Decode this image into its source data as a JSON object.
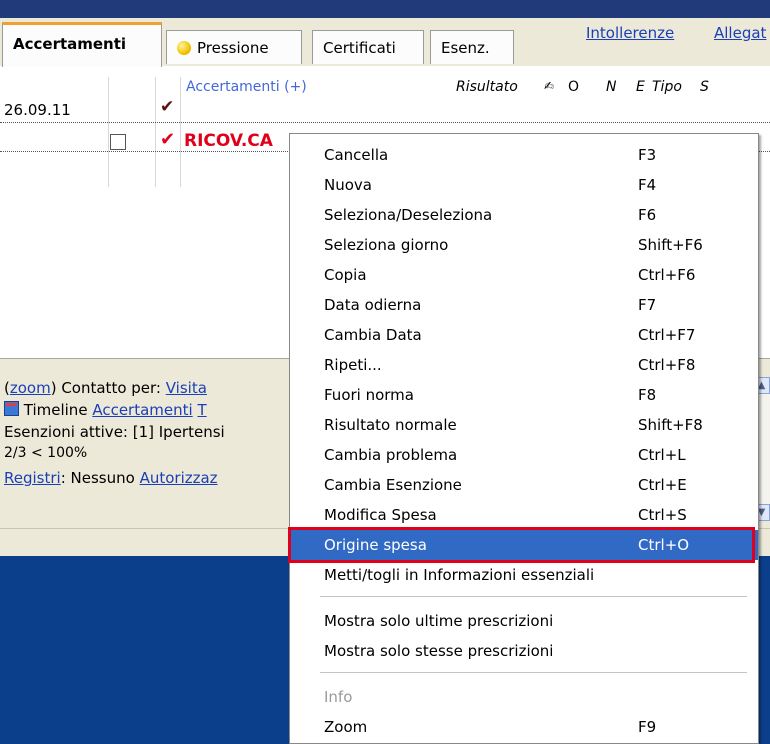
{
  "tabs": [
    {
      "label": "Accertamenti",
      "active": true
    },
    {
      "label": "Pressione",
      "active": false,
      "icon": "yellow-circle-icon"
    },
    {
      "label": "Certificati",
      "active": false
    },
    {
      "label": "Esenz.",
      "active": false
    }
  ],
  "top_links": [
    "Intollerenze",
    "Allegat"
  ],
  "grid": {
    "header": {
      "accertamenti": "Accertamenti (+)",
      "risultato": "Risultato",
      "col_icon": "✍",
      "o": "O",
      "n": "N",
      "e": "E",
      "tipo": "Tipo",
      "s": "S"
    },
    "rows": [
      {
        "date": "26.09.11",
        "check": "✔"
      },
      {
        "check": "✔",
        "name": "RICOV.CA"
      }
    ]
  },
  "info": {
    "line1_zoom": "zoom",
    "line1_paren_open": "(",
    "line1_paren_close": ")",
    "line1_text": " Contatto per: ",
    "line1_link": "Visita",
    "line2_text": " Timeline ",
    "line2_link1": "Accertamenti",
    "line2_link2": "T",
    "line3_text": "Esenzioni attive: [1] Ipertensi",
    "line4_text": "2/3 < 100%",
    "line5_link1": "Registri",
    "line5_text": ": Nessuno ",
    "line5_link2": "Autorizzaz"
  },
  "context_menu": {
    "items": [
      {
        "label": "Cancella",
        "shortcut": "F3"
      },
      {
        "label": "Nuova",
        "shortcut": "F4"
      },
      {
        "label": "Seleziona/Deseleziona",
        "shortcut": "F6"
      },
      {
        "label": "Seleziona giorno",
        "shortcut": "Shift+F6"
      },
      {
        "label": "Copia",
        "shortcut": "Ctrl+F6"
      },
      {
        "label": "Data odierna",
        "shortcut": "F7"
      },
      {
        "label": "Cambia Data",
        "shortcut": "Ctrl+F7"
      },
      {
        "label": "Ripeti...",
        "shortcut": "Ctrl+F8"
      },
      {
        "label": "Fuori norma",
        "shortcut": "F8"
      },
      {
        "label": "Risultato normale",
        "shortcut": "Shift+F8"
      },
      {
        "label": "Cambia problema",
        "shortcut": "Ctrl+L"
      },
      {
        "label": "Cambia Esenzione",
        "shortcut": "Ctrl+E"
      },
      {
        "label": "Modifica Spesa",
        "shortcut": "Ctrl+S"
      },
      {
        "label": "Origine spesa",
        "shortcut": "Ctrl+O",
        "selected": true
      },
      {
        "label": "Metti/togli in Informazioni essenziali",
        "shortcut": ""
      },
      {
        "label": "Mostra solo ultime prescrizioni",
        "shortcut": ""
      },
      {
        "label": "Mostra solo stesse prescrizioni",
        "shortcut": ""
      },
      {
        "label": "Info",
        "shortcut": "",
        "disabled": true
      },
      {
        "label": "Zoom",
        "shortcut": "F9"
      }
    ]
  },
  "colors": {
    "accent_link": "#1a3fb8",
    "menu_selected": "#316ac5",
    "highlight_border": "#e0001b",
    "red_text": "#e0001b",
    "background_blue": "#0b3f8c"
  }
}
